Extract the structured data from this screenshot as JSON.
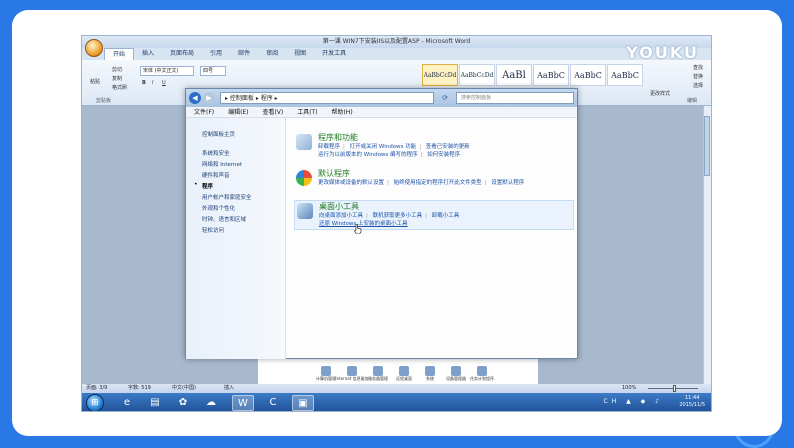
{
  "word": {
    "title": "第一课 WIN7下安装IIS以及配置ASP - Microsoft Word",
    "watermark": "YOUKU",
    "tabs": [
      "开始",
      "插入",
      "页面布局",
      "引用",
      "邮件",
      "审阅",
      "视图",
      "开发工具"
    ],
    "active_tab_index": 0,
    "clipboard": {
      "paste": "粘贴",
      "cut": "剪切",
      "copy": "复制",
      "format_painter": "格式刷",
      "group": "剪贴板"
    },
    "font_name": "宋体 (中文正文)",
    "font_size": "四号",
    "styles": [
      "AaBbCcDd",
      "AaBbCcDd",
      "AaBl",
      "AaBbC",
      "AaBbC",
      "AaBbC"
    ],
    "change_styles": "更改样式",
    "editing": {
      "find": "查找",
      "replace": "替换",
      "select": "选择",
      "group": "编辑"
    },
    "status": {
      "page": "页面: 3/9",
      "words": "字数: 519",
      "lang": "中文(中国)",
      "mode": "插入",
      "zoom": "100%"
    },
    "doc_thumbs": [
      "计算机管理",
      "Internet 信息服务",
      "服务器管理",
      "远程桌面",
      "系统",
      "设备管理器",
      "任务计划程序"
    ]
  },
  "explorer": {
    "breadcrumb": "▸ 控制面板 ▸ 程序 ▸",
    "search_placeholder": "搜索控制面板",
    "menu": [
      "文件(F)",
      "编辑(E)",
      "查看(V)",
      "工具(T)",
      "帮助(H)"
    ],
    "nav": {
      "home": "控制面板主页",
      "items": [
        "系统和安全",
        "网络和 Internet",
        "硬件和声音",
        "程序",
        "用户帐户和家庭安全",
        "外观和个性化",
        "时钟、语言和区域",
        "轻松访问"
      ],
      "current_index": 3
    },
    "categories": [
      {
        "title": "程序和功能",
        "links_line1": [
          "卸载程序",
          "打开或关闭 Windows 功能",
          "查看已安装的更新"
        ],
        "links_line2": [
          "运行为以前版本的 Windows 编写的程序",
          "如何安装程序"
        ]
      },
      {
        "title": "默认程序",
        "links_line1": [
          "更改媒体或设备的默认设置",
          "始终使用指定的程序打开此文件类型",
          "设置默认程序"
        ],
        "links_line2": []
      },
      {
        "title": "桌面小工具",
        "links_line1": [
          "向桌面添加小工具",
          "联机获取更多小工具",
          "卸载小工具"
        ],
        "links_line2": [
          "还原 Windows 上安装的桌面小工具"
        ]
      }
    ]
  },
  "taskbar": {
    "time": "11:44",
    "date": "2015/11/5",
    "tray_text": "CH"
  }
}
